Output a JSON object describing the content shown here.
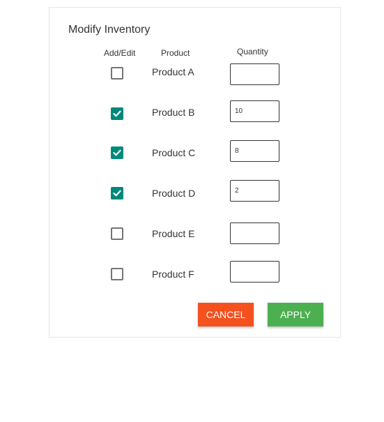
{
  "panel": {
    "title": "Modify Inventory",
    "headers": {
      "add_edit": "Add/Edit",
      "product": "Product",
      "quantity": "Quantity"
    },
    "rows": [
      {
        "product": "Product A",
        "checked": false,
        "quantity": ""
      },
      {
        "product": "Product B",
        "checked": true,
        "quantity": "10"
      },
      {
        "product": "Product C",
        "checked": true,
        "quantity": "8"
      },
      {
        "product": "Product D",
        "checked": true,
        "quantity": "2"
      },
      {
        "product": "Product E",
        "checked": false,
        "quantity": ""
      },
      {
        "product": "Product F",
        "checked": false,
        "quantity": ""
      }
    ],
    "actions": {
      "cancel_label": "CANCEL",
      "apply_label": "APPLY"
    }
  },
  "colors": {
    "check_accent": "#00897b",
    "cancel": "#f4511e",
    "apply": "#4caf50"
  },
  "icons": {
    "checkmark": "check-icon"
  }
}
